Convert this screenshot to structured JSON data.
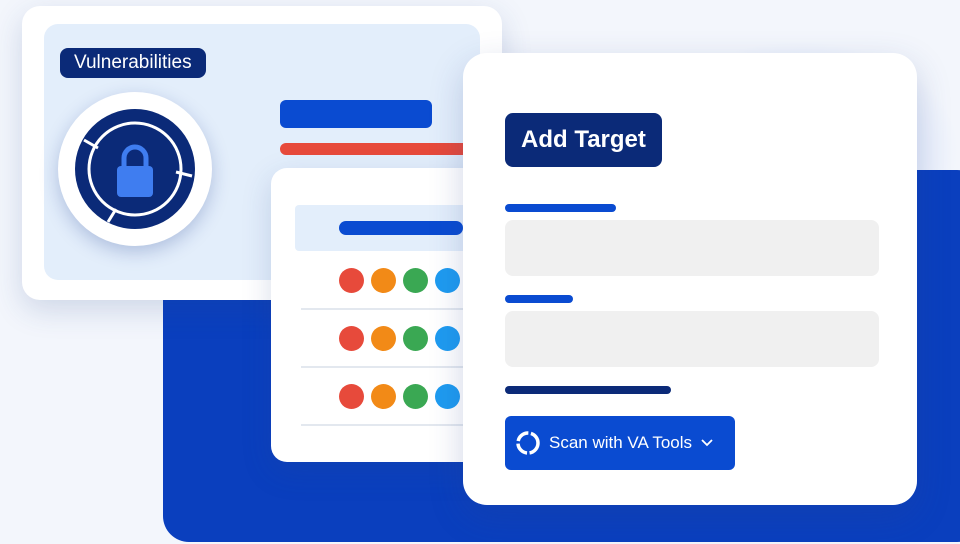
{
  "vulnerabilities_card": {
    "badge_label": "Vulnerabilities",
    "icon": "lock-icon",
    "bar_colors": [
      "#0a4bd1",
      "#e74a3b",
      "#3aa853",
      "#f28a17"
    ]
  },
  "results_card": {
    "status_dot_colors": [
      "#e74a3b",
      "#f28a17",
      "#3aa853",
      "#1e9bf0"
    ],
    "row_count": 3
  },
  "add_target_form": {
    "title": "Add Target",
    "scan_button": {
      "label": "Scan with VA Tools",
      "icon": "spinner-icon",
      "dropdown_icon": "chevron-down-icon"
    }
  },
  "colors": {
    "navy": "#0b2a78",
    "accent_blue": "#0a4bd1",
    "background": "#f3f6fc",
    "input_gray": "#f0f0f0"
  }
}
